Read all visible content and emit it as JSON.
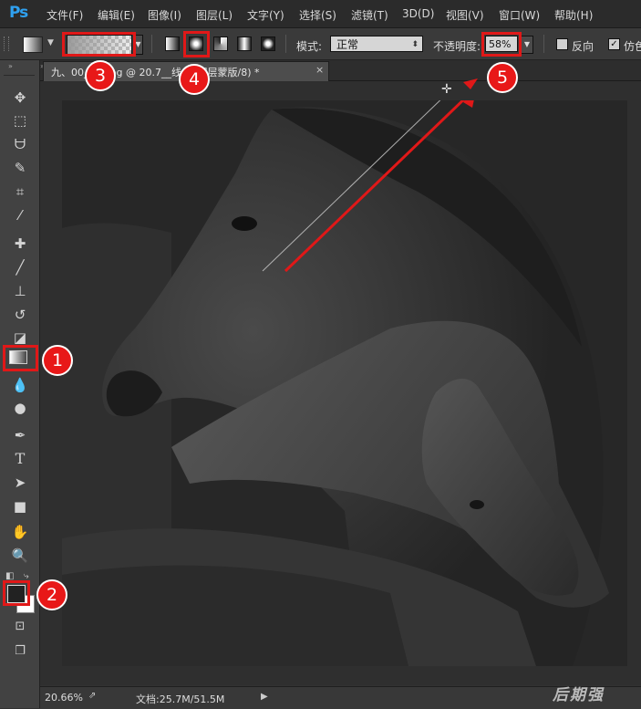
{
  "app": {
    "logo": "Ps"
  },
  "menu": {
    "file": "文件(F)",
    "edit": "编辑(E)",
    "image": "图像(I)",
    "layer": "图层(L)",
    "type": "文字(Y)",
    "select": "选择(S)",
    "filter": "滤镜(T)",
    "three_d": "3D(D)",
    "view": "视图(V)",
    "window": "窗口(W)",
    "help": "帮助(H)"
  },
  "options": {
    "mode_label": "模式:",
    "mode_value": "正常",
    "opacity_label": "不透明度:",
    "opacity_value": "58%",
    "reverse_label": "反向",
    "dither_label": "仿色",
    "reverse_checked": false,
    "dither_checked": true,
    "selected_gradient_type": "radial"
  },
  "document": {
    "tab_title": "九、00__图.jpg @ 20.7__线 1, 图层蒙版/8) *",
    "close_symbol": "×"
  },
  "status": {
    "zoom": "20.66%",
    "doc_info": "文档:25.7M/51.5M"
  },
  "watermark": "后期强",
  "callouts": {
    "c1": "1",
    "c2": "2",
    "c3": "3",
    "c4": "4",
    "c5": "5"
  },
  "colors": {
    "highlight": "#e01818",
    "ps_blue": "#2fa1f0",
    "foreground": "#222222",
    "background": "#ffffff"
  },
  "icons": {
    "move": "move-icon",
    "marquee": "rect-marquee-icon",
    "lasso": "lasso-icon",
    "quick_select": "quick-select-icon",
    "crop": "crop-icon",
    "eyedropper": "eyedropper-icon",
    "healing": "healing-brush-icon",
    "brush": "brush-icon",
    "stamp": "clone-stamp-icon",
    "history_brush": "history-brush-icon",
    "eraser": "eraser-icon",
    "gradient": "gradient-icon",
    "blur": "blur-icon",
    "dodge": "dodge-icon",
    "pen": "pen-icon",
    "type": "type-icon",
    "path_select": "path-select-icon",
    "shape": "rectangle-shape-icon",
    "hand": "hand-icon",
    "zoom": "zoom-icon",
    "quick_mask": "quick-mask-icon",
    "screen_mode": "screen-mode-icon"
  }
}
